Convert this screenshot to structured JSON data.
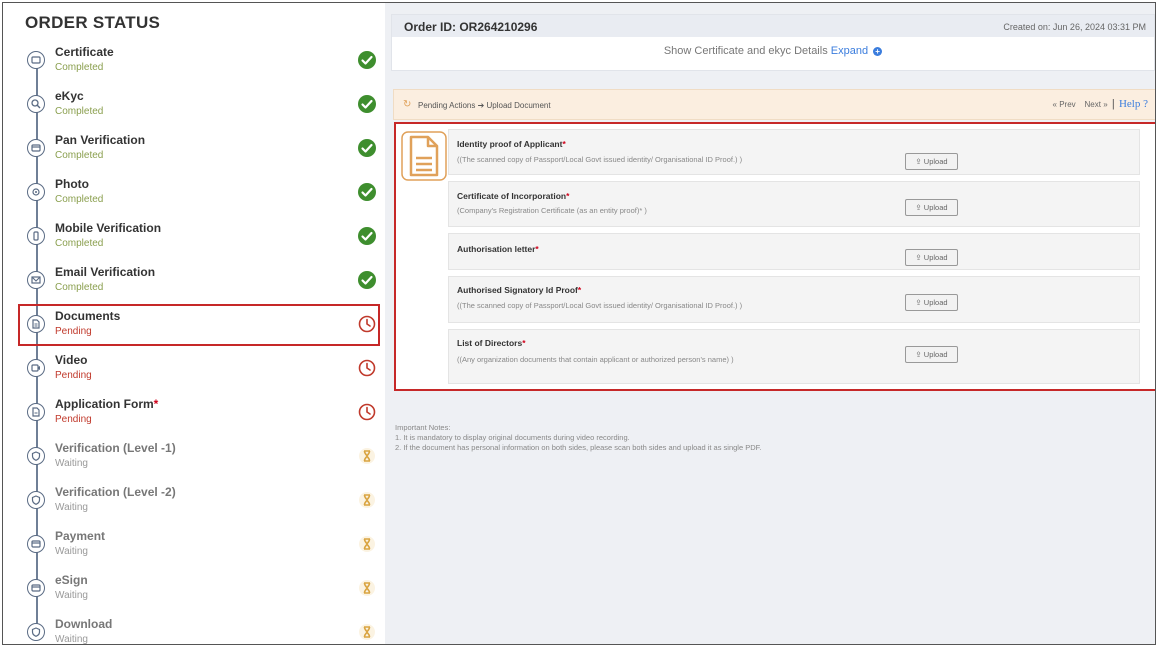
{
  "sidebar": {
    "title": "ORDER STATUS",
    "steps": [
      {
        "name": "Certificate",
        "required": "",
        "status": "Completed",
        "state": "completed",
        "icon": "certificate-icon"
      },
      {
        "name": "eKyc",
        "required": "",
        "status": "Completed",
        "state": "completed",
        "icon": "search-icon"
      },
      {
        "name": "Pan Verification",
        "required": "",
        "status": "Completed",
        "state": "completed",
        "icon": "card-icon"
      },
      {
        "name": "Photo",
        "required": "",
        "status": "Completed",
        "state": "completed",
        "icon": "camera-icon"
      },
      {
        "name": "Mobile Verification",
        "required": "",
        "status": "Completed",
        "state": "completed",
        "icon": "mobile-icon"
      },
      {
        "name": "Email Verification",
        "required": "",
        "status": "Completed",
        "state": "completed",
        "icon": "mail-icon"
      },
      {
        "name": "Documents",
        "required": "",
        "status": "Pending",
        "state": "pending",
        "icon": "document-icon"
      },
      {
        "name": "Video",
        "required": "",
        "status": "Pending",
        "state": "pending",
        "icon": "video-icon"
      },
      {
        "name": "Application Form",
        "required": "*",
        "status": "Pending",
        "state": "pending",
        "icon": "form-icon"
      },
      {
        "name": "Verification (Level -1)",
        "required": "",
        "status": "Waiting",
        "state": "waiting",
        "icon": "shield-icon"
      },
      {
        "name": "Verification (Level -2)",
        "required": "",
        "status": "Waiting",
        "state": "waiting",
        "icon": "shield-icon"
      },
      {
        "name": "Payment",
        "required": "",
        "status": "Waiting",
        "state": "waiting",
        "icon": "card-icon"
      },
      {
        "name": "eSign",
        "required": "",
        "status": "Waiting",
        "state": "waiting",
        "icon": "card-icon"
      },
      {
        "name": "Download",
        "required": "",
        "status": "Waiting",
        "state": "waiting",
        "icon": "shield-icon"
      }
    ]
  },
  "order": {
    "id_label": "Order ID: OR264210296",
    "created_on": "Created on: Jun 26, 2024 03:31 PM",
    "expand_text": "Show Certificate and ekyc Details",
    "expand_link": "Expand"
  },
  "pending_bar": {
    "breadcrumb": "Pending Actions ➔ Upload Document",
    "prev": "« Prev",
    "next": "Next »",
    "separator": "|",
    "help": "Help ?"
  },
  "documents": [
    {
      "title": "Identity proof of Applicant",
      "required": "*",
      "desc": "((The scanned copy of Passport/Local Govt issued identity/ Organisational ID Proof.) )",
      "upload": "⇪ Upload"
    },
    {
      "title": "Certificate of Incorporation",
      "required": "*",
      "desc": "(Company's Registration Certificate (as an entity proof)* )",
      "upload": "⇪ Upload"
    },
    {
      "title": "Authorisation letter",
      "required": "*",
      "desc": "",
      "upload": "⇪ Upload"
    },
    {
      "title": "Authorised Signatory Id Proof",
      "required": "*",
      "desc": "((The scanned copy of Passport/Local Govt issued identity/ Organisational ID Proof.) )",
      "upload": "⇪ Upload"
    },
    {
      "title": "List of Directors",
      "required": "*",
      "desc": "((Any organization documents that contain applicant or authorized person's name) )",
      "upload": "⇪ Upload"
    }
  ],
  "notes": {
    "heading": "Important Notes:",
    "line1": "1. It is mandatory to display original documents during video recording.",
    "line2": "2. If the document has personal information on both sides, please scan both sides and upload it as single PDF."
  },
  "colors": {
    "completed": "#3e8e2e",
    "pending": "#c0392b",
    "waiting": "#d9a441",
    "highlight": "#c62828",
    "link": "#3b7ddd"
  }
}
